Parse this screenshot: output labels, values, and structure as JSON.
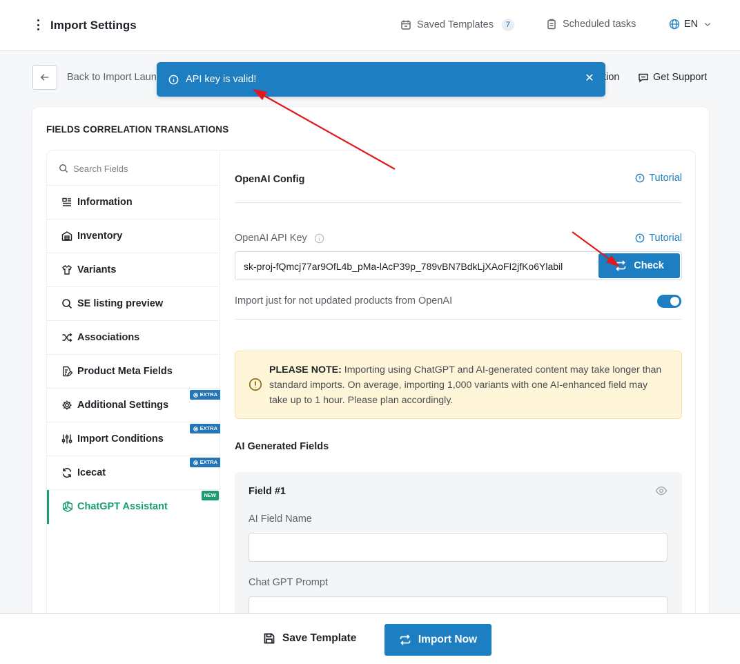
{
  "header": {
    "title": "Import Settings",
    "saved_templates_label": "Saved Templates",
    "saved_templates_count": "7",
    "scheduled_tasks_label": "Scheduled tasks",
    "language": "EN"
  },
  "subheader": {
    "back_label": "Back to Import Laun",
    "partial_link": "ation",
    "support_label": "Get Support"
  },
  "toast": {
    "message": "API key is valid!"
  },
  "card": {
    "title": "FIELDS CORRELATION TRANSLATIONS"
  },
  "sidebar": {
    "search_placeholder": "Search Fields",
    "items": [
      {
        "label": "Information",
        "icon": "list-icon"
      },
      {
        "label": "Inventory",
        "icon": "warehouse-icon"
      },
      {
        "label": "Variants",
        "icon": "shirt-icon"
      },
      {
        "label": "SE listing preview",
        "icon": "search-icon"
      },
      {
        "label": "Associations",
        "icon": "shuffle-icon"
      },
      {
        "label": "Product Meta Fields",
        "icon": "document-edit-icon"
      },
      {
        "label": "Additional Settings",
        "icon": "gear-icon",
        "badge": "EXTRA"
      },
      {
        "label": "Import Conditions",
        "icon": "sliders-icon",
        "badge": "EXTRA"
      },
      {
        "label": "Icecat",
        "icon": "refresh-icon",
        "badge": "EXTRA"
      },
      {
        "label": "ChatGPT Assistant",
        "icon": "openai-icon",
        "badge": "NEW",
        "active": true
      }
    ]
  },
  "content": {
    "section_title": "OpenAI Config",
    "tutorial_label": "Tutorial",
    "api_key_label": "OpenAI API Key",
    "api_key_value": "sk-proj-fQmcj77ar9OfL4b_pMa-lAcP39p_789vBN7BdkLjXAoFI2jfKo6Ylabil",
    "check_label": "Check",
    "toggle_label": "Import just for not updated products from OpenAI",
    "toggle_on": true,
    "note_strong": "PLEASE NOTE:",
    "note_text": " Importing using ChatGPT and AI-generated content may take longer than standard imports. On average, importing 1,000 variants with one AI-enhanced field may take up to 1 hour. Please plan accordingly.",
    "ai_fields_title": "AI Generated Fields",
    "field_title": "Field #1",
    "field_name_label": "AI Field Name",
    "prompt_label": "Chat GPT Prompt"
  },
  "footer": {
    "save_label": "Save Template",
    "import_label": "Import Now"
  },
  "colors": {
    "accent": "#1e7ec2",
    "active_green": "#1a9e6e",
    "note_bg": "#fff5d8",
    "annotation_red": "#e0191c"
  }
}
